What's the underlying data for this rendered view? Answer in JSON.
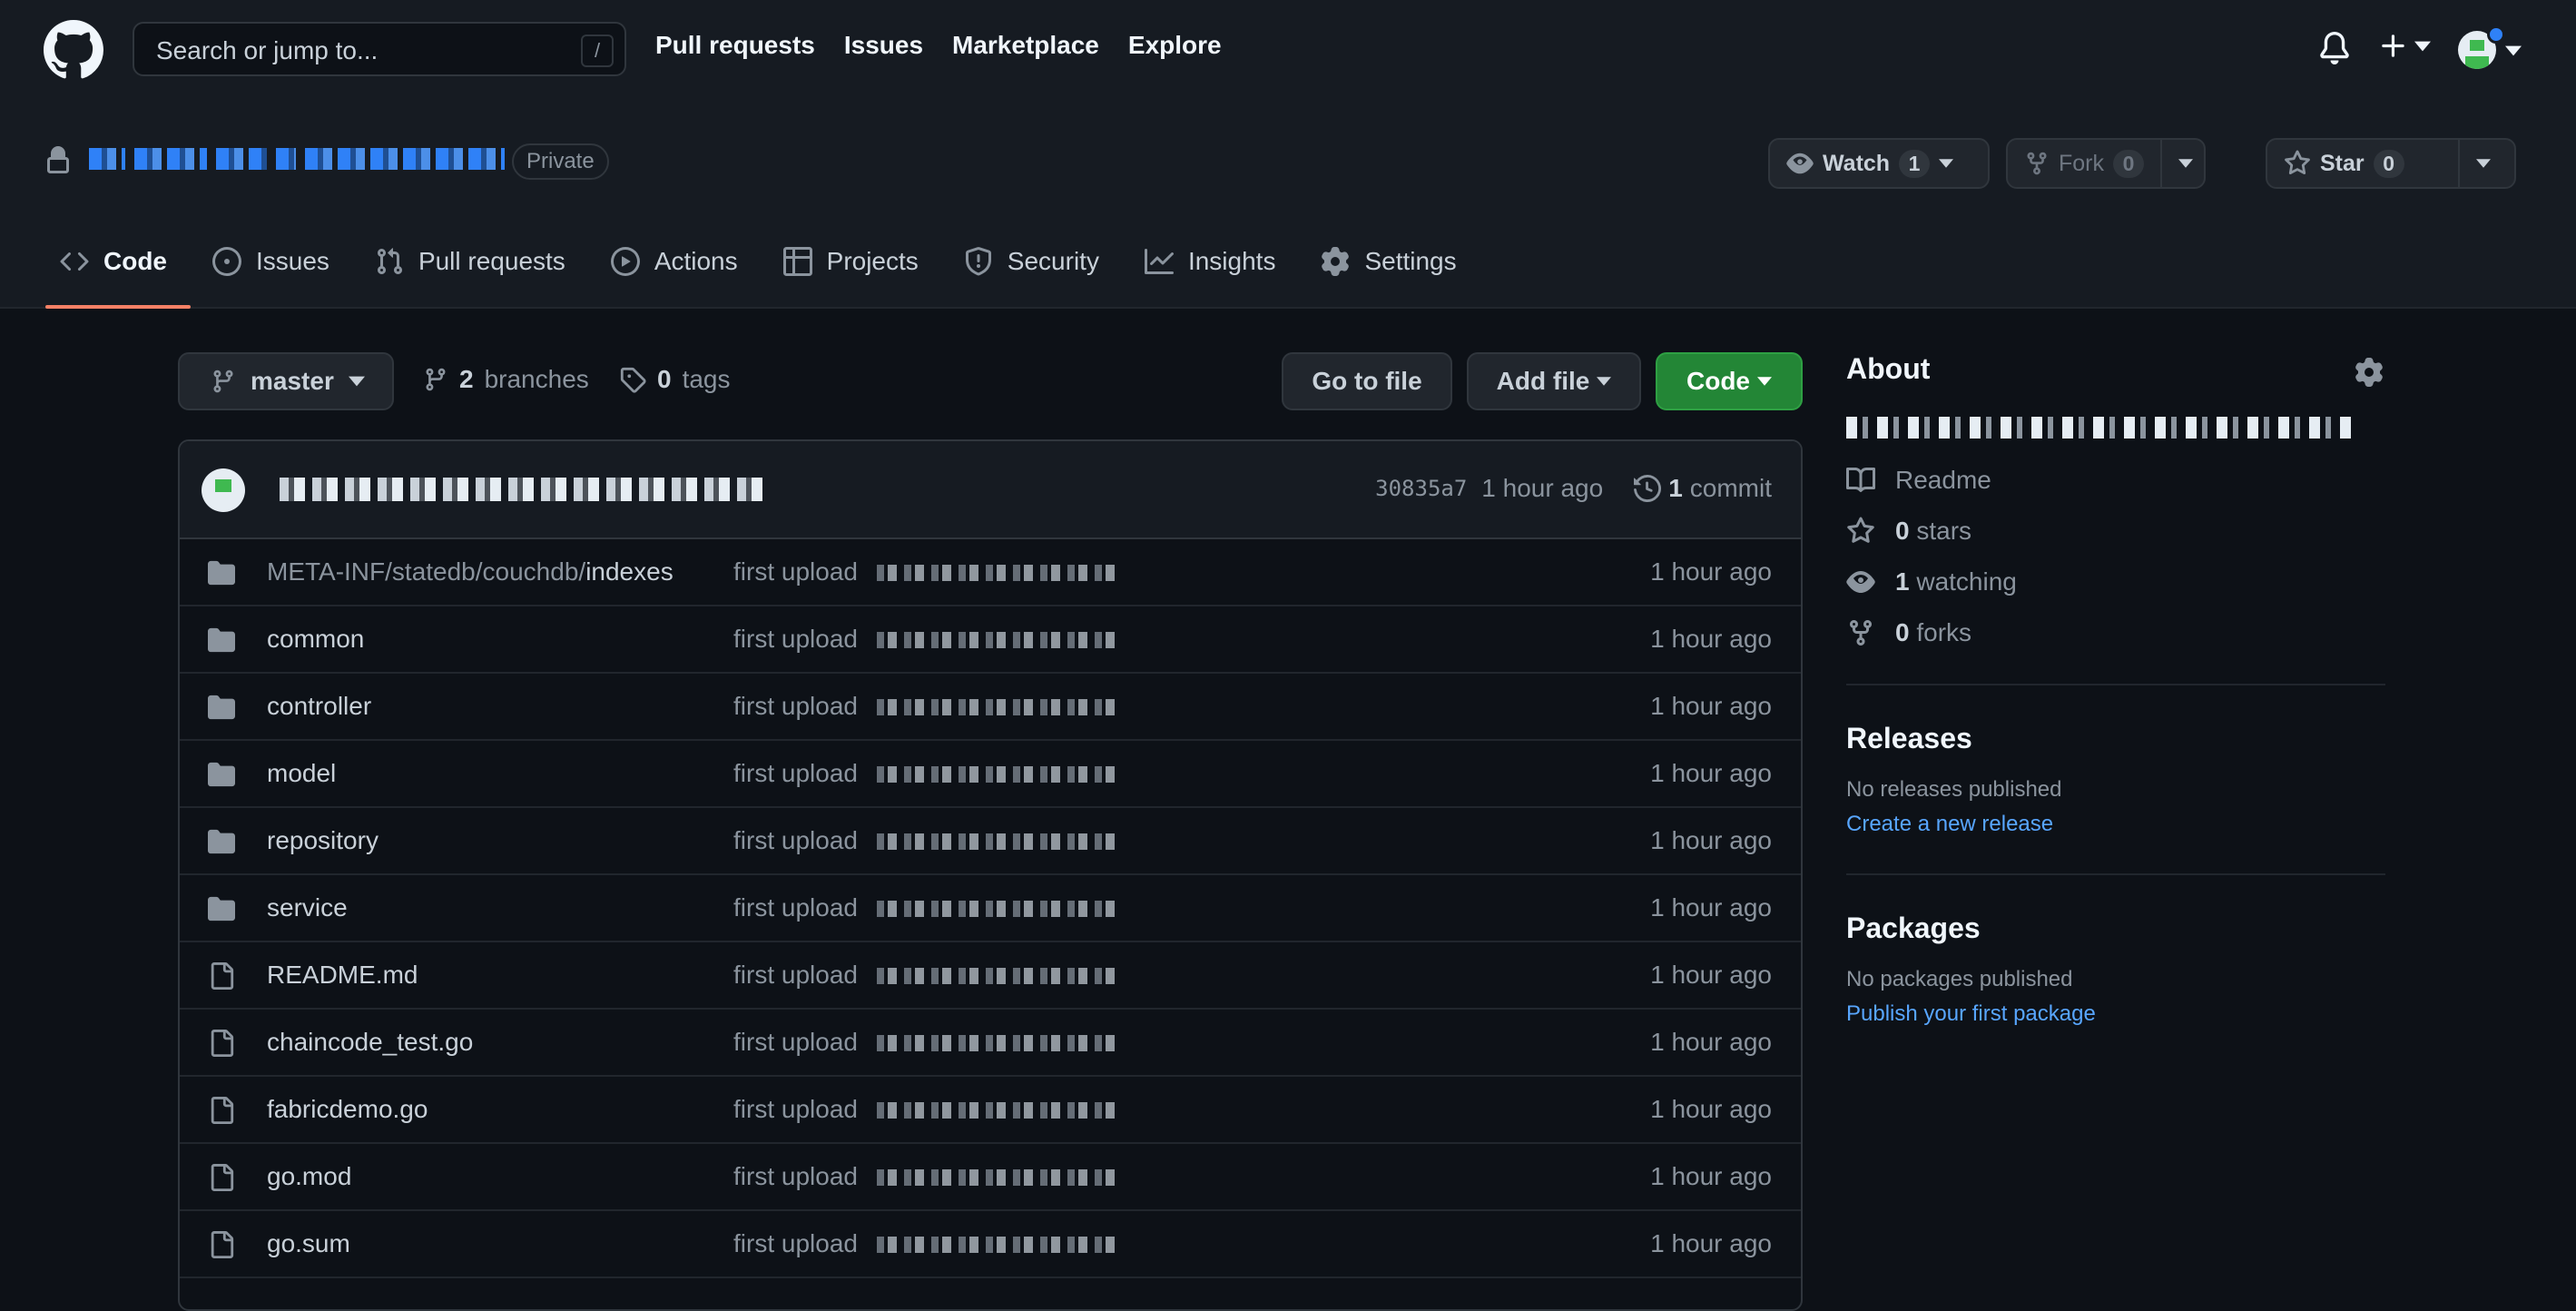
{
  "header": {
    "search_placeholder": "Search or jump to...",
    "search_shortcut": "/",
    "nav": [
      "Pull requests",
      "Issues",
      "Marketplace",
      "Explore"
    ]
  },
  "repo": {
    "visibility": "Private",
    "watch": {
      "label": "Watch",
      "count": "1"
    },
    "fork": {
      "label": "Fork",
      "count": "0"
    },
    "star": {
      "label": "Star",
      "count": "0"
    }
  },
  "tabs": [
    {
      "label": "Code",
      "icon": "code-icon",
      "active": true
    },
    {
      "label": "Issues",
      "icon": "issue-icon"
    },
    {
      "label": "Pull requests",
      "icon": "pull-request-icon"
    },
    {
      "label": "Actions",
      "icon": "play-icon"
    },
    {
      "label": "Projects",
      "icon": "table-icon"
    },
    {
      "label": "Security",
      "icon": "shield-icon"
    },
    {
      "label": "Insights",
      "icon": "graph-icon"
    },
    {
      "label": "Settings",
      "icon": "gear-icon"
    }
  ],
  "toolbar": {
    "branch": "master",
    "branches_count": "2",
    "branches_label": "branches",
    "tags_count": "0",
    "tags_label": "tags",
    "go_to_file": "Go to file",
    "add_file": "Add file",
    "code": "Code"
  },
  "commit": {
    "sha": "30835a7",
    "age": "1 hour ago",
    "count": "1",
    "count_label": "commit"
  },
  "files": [
    {
      "type": "dir",
      "prefix": "META-INF/statedb/couchdb/",
      "name": "indexes",
      "message": "first upload",
      "age": "1 hour ago"
    },
    {
      "type": "dir",
      "prefix": "",
      "name": "common",
      "message": "first upload",
      "age": "1 hour ago"
    },
    {
      "type": "dir",
      "prefix": "",
      "name": "controller",
      "message": "first upload",
      "age": "1 hour ago"
    },
    {
      "type": "dir",
      "prefix": "",
      "name": "model",
      "message": "first upload",
      "age": "1 hour ago"
    },
    {
      "type": "dir",
      "prefix": "",
      "name": "repository",
      "message": "first upload",
      "age": "1 hour ago"
    },
    {
      "type": "dir",
      "prefix": "",
      "name": "service",
      "message": "first upload",
      "age": "1 hour ago"
    },
    {
      "type": "file",
      "prefix": "",
      "name": "README.md",
      "message": "first upload",
      "age": "1 hour ago"
    },
    {
      "type": "file",
      "prefix": "",
      "name": "chaincode_test.go",
      "message": "first upload",
      "age": "1 hour ago"
    },
    {
      "type": "file",
      "prefix": "",
      "name": "fabricdemo.go",
      "message": "first upload",
      "age": "1 hour ago"
    },
    {
      "type": "file",
      "prefix": "",
      "name": "go.mod",
      "message": "first upload",
      "age": "1 hour ago"
    },
    {
      "type": "file",
      "prefix": "",
      "name": "go.sum",
      "message": "first upload",
      "age": "1 hour ago"
    }
  ],
  "about": {
    "title": "About",
    "readme": "Readme",
    "stars_count": "0",
    "stars_label": "stars",
    "watching_count": "1",
    "watching_label": "watching",
    "forks_count": "0",
    "forks_label": "forks"
  },
  "releases": {
    "title": "Releases",
    "empty": "No releases published",
    "link": "Create a new release"
  },
  "packages": {
    "title": "Packages",
    "empty": "No packages published",
    "link": "Publish your first package"
  },
  "colors": {
    "bg": "#0d1117",
    "header_bg": "#161b22",
    "accent_tab": "#f78166",
    "green_button": "#238636",
    "link": "#58a6ff"
  }
}
